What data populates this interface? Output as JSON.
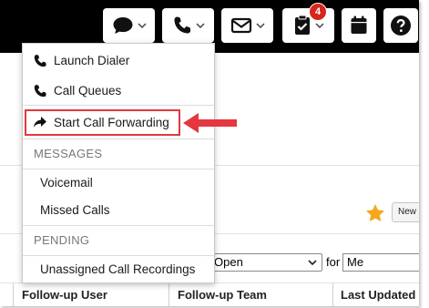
{
  "topbar": {
    "tasks_badge": "4"
  },
  "menu": {
    "items": [
      {
        "label": "Launch Dialer"
      },
      {
        "label": "Call Queues"
      },
      {
        "label": "Start Call Forwarding"
      }
    ],
    "sections": [
      {
        "title": "MESSAGES",
        "items": [
          {
            "label": "Voicemail"
          },
          {
            "label": "Missed Calls"
          }
        ]
      },
      {
        "title": "PENDING",
        "items": [
          {
            "label": "Unassigned Call Recordings"
          }
        ]
      }
    ]
  },
  "page": {
    "new_button": "New",
    "status_select": "Open",
    "for_label": "for",
    "for_value": "Me",
    "columns": [
      "Follow-up User",
      "Follow-up Team",
      "Last Updated"
    ]
  },
  "colors": {
    "highlight": "#e4373f",
    "badge": "#d5261c",
    "star": "#f4a81d"
  },
  "icons": [
    "chat-icon",
    "phone-icon",
    "envelope-icon",
    "clipboard-check-icon",
    "calendar-icon",
    "help-icon",
    "phone-forward-icon",
    "star-icon",
    "arrow-left-icon"
  ]
}
